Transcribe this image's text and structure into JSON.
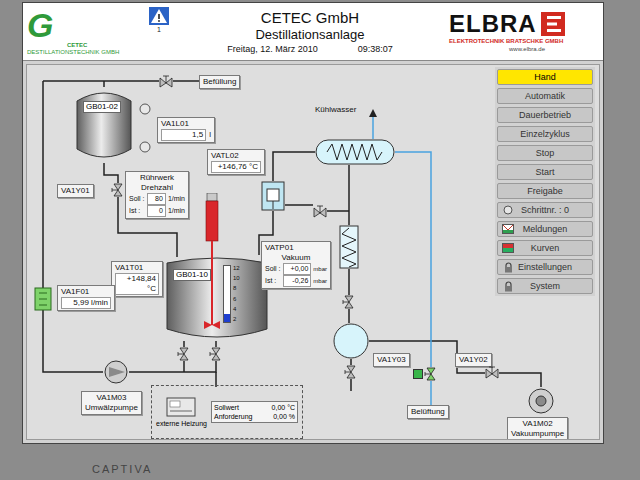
{
  "monitor": {
    "brand": "CAPTIVA"
  },
  "header": {
    "logo_left": {
      "mark": "G",
      "line1": "CETEC",
      "line2": "DESTILLATIONSTECHNIK GMBH"
    },
    "alarm": {
      "count": "1"
    },
    "company": "CETEC GmbH",
    "title": "Destillationsanlage",
    "date": "Freitag, 12. März 2010",
    "time": "09:38:07",
    "logo_right": {
      "mark": "ELBRA",
      "subtitle": "ELEKTROTECHNIK BRATSCHKE GMBH",
      "url": "www.elbra.de"
    }
  },
  "menu": [
    {
      "label": "Hand",
      "selected": true,
      "kind": "button"
    },
    {
      "label": "Automatik",
      "selected": false,
      "kind": "button"
    },
    {
      "label": "Dauerbetrieb",
      "selected": false,
      "kind": "button"
    },
    {
      "label": "Einzelzyklus",
      "selected": false,
      "kind": "button"
    },
    {
      "label": "Stop",
      "selected": false,
      "kind": "button"
    },
    {
      "label": "Start",
      "selected": false,
      "kind": "button"
    },
    {
      "label": "Freigabe",
      "selected": false,
      "kind": "button"
    },
    {
      "label": "Schrittnr. : 0",
      "selected": false,
      "kind": "step"
    },
    {
      "label": "Meldungen",
      "selected": false,
      "kind": "messages"
    },
    {
      "label": "Kurven",
      "selected": false,
      "kind": "curves"
    },
    {
      "label": "Einstellungen",
      "selected": false,
      "kind": "locked"
    },
    {
      "label": "System",
      "selected": false,
      "kind": "locked"
    }
  ],
  "diagram": {
    "fill_label": "Befüllung",
    "tank_top": {
      "name": "GB01-02"
    },
    "level_sensor": {
      "tag": "VA1L01",
      "value": "1,5",
      "unit": "l"
    },
    "inlet_valve": {
      "tag": "VA1Y01"
    },
    "agitator": {
      "title": "Rührwerk",
      "subtitle": "Drehzahl",
      "rows": [
        {
          "label": "Soll :",
          "value": "80",
          "unit": "1/min"
        },
        {
          "label": "Ist :",
          "value": "0",
          "unit": "1/min"
        }
      ]
    },
    "vessel_temp": {
      "tag": "VA1T01",
      "value": "+148,84 °C"
    },
    "vessel": {
      "name": "GB01-10",
      "level": 0.15,
      "scale": [
        "12",
        "10",
        "8",
        "6",
        "4",
        "2"
      ]
    },
    "flow": {
      "tag": "VA1F01",
      "value": "5,99 l/min"
    },
    "circ_pump": {
      "tag": "VA1M03",
      "name": "Umwälzpumpe"
    },
    "heater": {
      "name": "externe Heizung",
      "rows": [
        {
          "label": "Sollwert",
          "value": "0,00 °C"
        },
        {
          "label": "Anforderung",
          "value": "0,00 %"
        }
      ]
    },
    "vapor_temp": {
      "tag": "VATL02",
      "value": "+146,76 °C"
    },
    "cooling_water": "Kühlwasser",
    "vacuum": {
      "tag": "VATP01",
      "name": "Vakuum",
      "rows": [
        {
          "label": "Soll :",
          "value": "+0,00",
          "unit": "mbar"
        },
        {
          "label": "Ist :",
          "value": "-0,26",
          "unit": "mbar"
        }
      ]
    },
    "vent_valve": {
      "tag": "VA1Y03",
      "on": true,
      "label": "Belüftung"
    },
    "vacuum_valve": {
      "tag": "VA1Y02",
      "on": false
    },
    "vacuum_pump": {
      "tag": "VA1M02",
      "name": "Vakuumpumpe"
    }
  }
}
